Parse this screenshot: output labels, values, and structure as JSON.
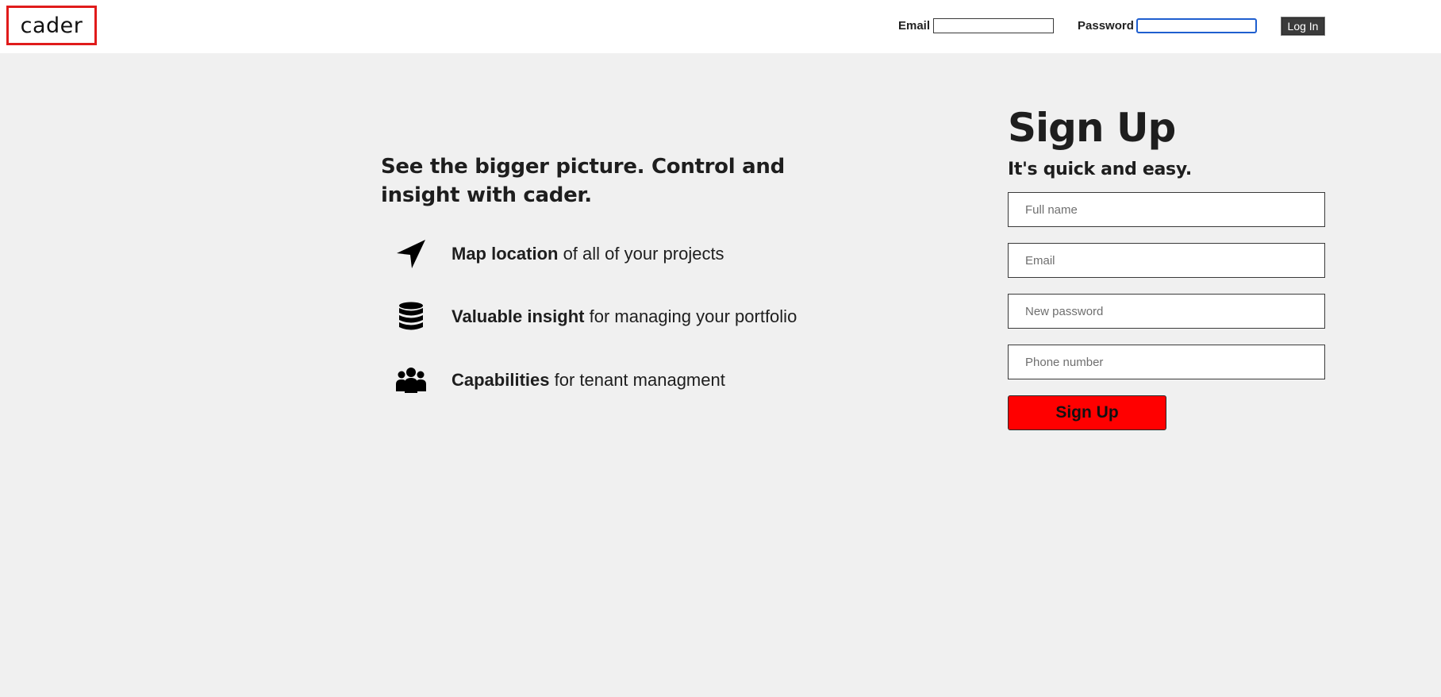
{
  "header": {
    "logo_text": "cader",
    "email_label": "Email",
    "email_value": "",
    "password_label": "Password",
    "password_value": "",
    "login_label": "Log In"
  },
  "promo": {
    "headline": "See the bigger picture. Control and insight with cader.",
    "features": [
      {
        "icon": "location-arrow-icon",
        "bold": "Map location",
        "text": " of all of your projects"
      },
      {
        "icon": "database-icon",
        "bold": "Valuable insight",
        "text": " for managing your portfolio"
      },
      {
        "icon": "users-icon",
        "bold": "Capabilities",
        "text": " for tenant managment"
      }
    ]
  },
  "signup": {
    "title": "Sign Up",
    "subtitle": "It's quick and easy.",
    "full_name_placeholder": "Full name",
    "email_placeholder": "Email",
    "password_placeholder": "New password",
    "phone_placeholder": "Phone number",
    "button_label": "Sign Up"
  },
  "colors": {
    "page_background": "#f0f0f0",
    "header_background": "#ffffff",
    "logo_border": "#e01b1b",
    "signup_button": "#ff0000",
    "login_button": "#3b3b3b",
    "focus_ring": "#1f5fcf"
  }
}
